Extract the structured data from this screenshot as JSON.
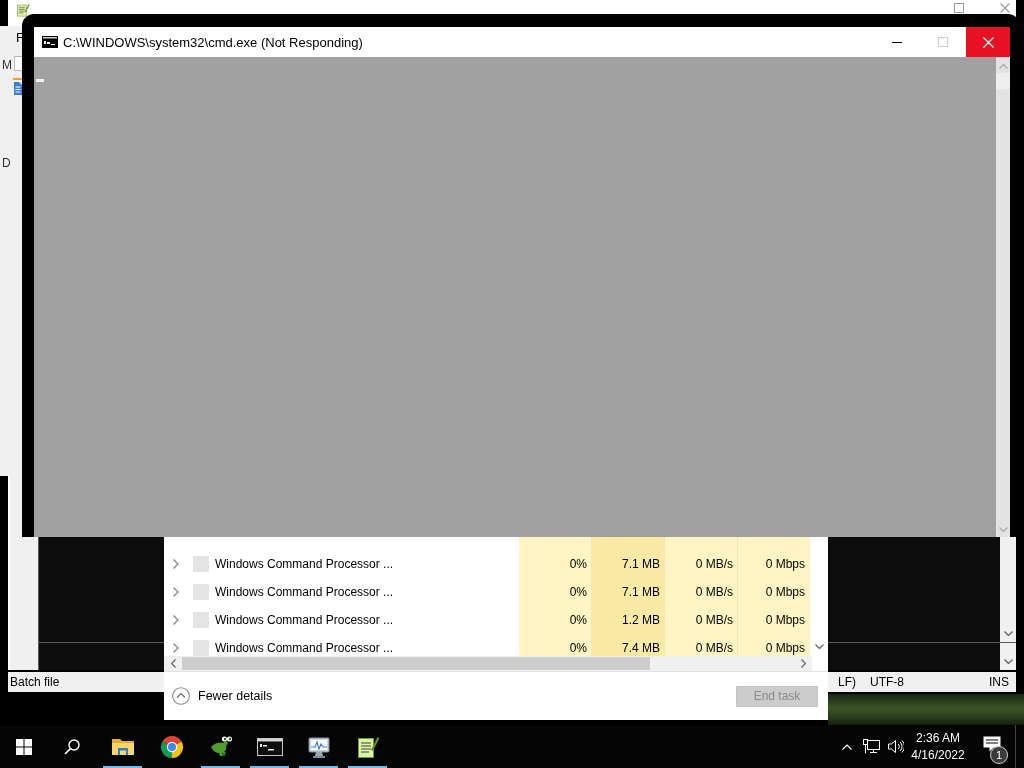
{
  "side_fragments": [
    "M",
    "D"
  ],
  "background_window": {
    "menu": [
      "F"
    ],
    "status_bar": [
      "Batch file",
      "LF)",
      "UTF-8",
      "INS"
    ]
  },
  "task_manager": {
    "rows": [
      {
        "name": "Windows Command Processor ...",
        "expanded": false,
        "cpu": "0%",
        "memory": "7.1 MB",
        "disk": "0 MB/s",
        "network": "0 Mbps"
      },
      {
        "name": "Windows Command Processor ...",
        "expanded": false,
        "cpu": "0%",
        "memory": "7.1 MB",
        "disk": "0 MB/s",
        "network": "0 Mbps"
      },
      {
        "name": "Windows Command Processor ...",
        "expanded": false,
        "cpu": "0%",
        "memory": "1.2 MB",
        "disk": "0 MB/s",
        "network": "0 Mbps"
      },
      {
        "name": "Windows Command Processor ...",
        "expanded": false,
        "cpu": "0%",
        "memory": "7.4 MB",
        "disk": "0 MB/s",
        "network": "0 Mbps"
      }
    ],
    "fewer_details": "Fewer details",
    "end_task": {
      "label": "End task",
      "disabled": true
    }
  },
  "console_window": {
    "title": "C:\\WINDOWS\\system32\\cmd.exe (Not Responding)",
    "maximize_disabled": true
  },
  "taskbar": {
    "apps": [
      {
        "kind": "folder",
        "running": true
      },
      {
        "kind": "browser",
        "running": false
      },
      {
        "kind": "lizard",
        "running": true
      },
      {
        "kind": "terminal",
        "running": true
      },
      {
        "kind": "monitor",
        "running": true
      },
      {
        "kind": "notepad",
        "running": true
      }
    ],
    "clock": {
      "time": "2:36 AM",
      "date": "4/16/2022"
    },
    "notification_count": "1"
  }
}
